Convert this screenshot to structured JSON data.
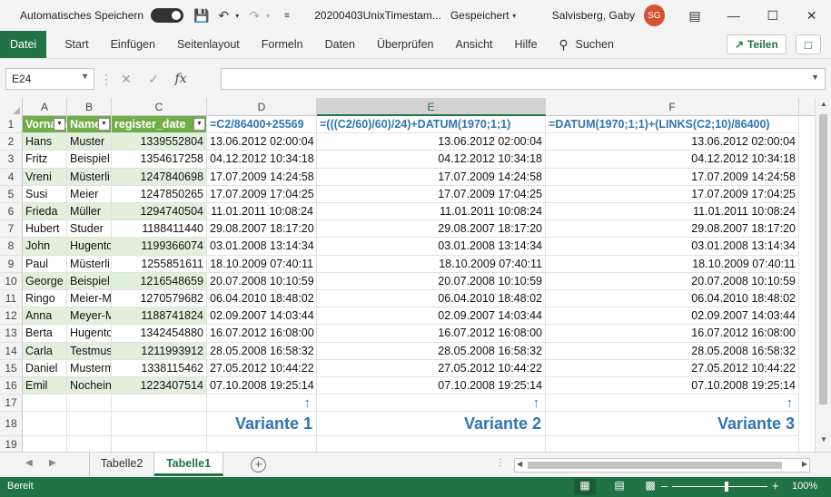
{
  "titlebar": {
    "autosave_label": "Automatisches Speichern",
    "filename": "20200403UnixTimestam...",
    "save_status": "Gespeichert",
    "user_name": "Salvisberg, Gaby",
    "user_initials": "SG"
  },
  "ribbon": {
    "tabs": [
      "Datei",
      "Start",
      "Einfügen",
      "Seitenlayout",
      "Formeln",
      "Daten",
      "Überprüfen",
      "Ansicht",
      "Hilfe"
    ],
    "search_label": "Suchen",
    "share_label": "Teilen"
  },
  "formula_bar": {
    "name_box": "E24",
    "formula": ""
  },
  "columns": [
    "A",
    "B",
    "C",
    "D",
    "E",
    "F"
  ],
  "selected_column": "E",
  "header_row": {
    "a": "Vorname",
    "b": "Name",
    "c": "register_date",
    "d": "=C2/86400+25569",
    "e": "=(((C2/60)/60)/24)+DATUM(1970;1;1)",
    "f": "=DATUM(1970;1;1)+(LINKS(C2;10)/86400)"
  },
  "rows": [
    {
      "a": "Hans",
      "b": "Muster",
      "c": "1339552804",
      "d": "13.06.2012 02:00:04"
    },
    {
      "a": "Fritz",
      "b": "Beispiel",
      "c": "1354617258",
      "d": "04.12.2012 10:34:18"
    },
    {
      "a": "Vreni",
      "b": "Müsterli",
      "c": "1247840698",
      "d": "17.07.2009 14:24:58"
    },
    {
      "a": "Susi",
      "b": "Meier",
      "c": "1247850265",
      "d": "17.07.2009 17:04:25"
    },
    {
      "a": "Frieda",
      "b": "Müller",
      "c": "1294740504",
      "d": "11.01.2011 10:08:24"
    },
    {
      "a": "Hubert",
      "b": "Studer",
      "c": "1188411440",
      "d": "29.08.2007 18:17:20"
    },
    {
      "a": "John",
      "b": "Hugentobler",
      "c": "1199366074",
      "d": "03.01.2008 13:14:34"
    },
    {
      "a": "Paul",
      "b": "Müsterli",
      "c": "1255851611",
      "d": "18.10.2009 07:40:11"
    },
    {
      "a": "George",
      "b": "Beispiel",
      "c": "1216548659",
      "d": "20.07.2008 10:10:59"
    },
    {
      "a": "Ringo",
      "b": "Meier-Müller",
      "c": "1270579682",
      "d": "06.04.2010 18:48:02"
    },
    {
      "a": "Anna",
      "b": "Meyer-Müller",
      "c": "1188741824",
      "d": "02.09.2007 14:03:44"
    },
    {
      "a": "Berta",
      "b": "Hugentobler",
      "c": "1342454880",
      "d": "16.07.2012 16:08:00"
    },
    {
      "a": "Carla",
      "b": "Testmuster",
      "c": "1211993912",
      "d": "28.05.2008 16:58:32"
    },
    {
      "a": "Daniel",
      "b": "Mustermann",
      "c": "1338115462",
      "d": "27.05.2012 10:44:22"
    },
    {
      "a": "Emil",
      "b": "Nocheiner",
      "c": "1223407514",
      "d": "07.10.2008 19:25:14"
    }
  ],
  "variants": [
    "Variante 1",
    "Variante 2",
    "Variante 3"
  ],
  "sheets": [
    "Tabelle2",
    "Tabelle1"
  ],
  "active_sheet": "Tabelle1",
  "status": {
    "mode": "Bereit",
    "zoom": "100%"
  },
  "colors": {
    "excel_green": "#217346",
    "table_header": "#70ad47",
    "band": "#e2efda",
    "formula_blue": "#2e75b6"
  }
}
